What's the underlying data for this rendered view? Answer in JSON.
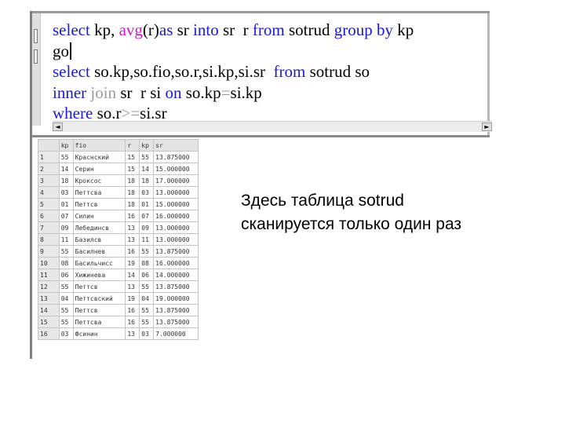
{
  "editor": {
    "lines": [
      [
        {
          "t": "select ",
          "c": "kw"
        },
        {
          "t": "kp, ",
          "c": "txt"
        },
        {
          "t": "avg",
          "c": "fn"
        },
        {
          "t": "(r)",
          "c": "txt"
        },
        {
          "t": "as ",
          "c": "kw"
        },
        {
          "t": "sr ",
          "c": "txt"
        },
        {
          "t": "into ",
          "c": "kw"
        },
        {
          "t": "sr  r ",
          "c": "txt"
        },
        {
          "t": "from ",
          "c": "kw"
        },
        {
          "t": "sotrud ",
          "c": "txt"
        },
        {
          "t": "group by ",
          "c": "kw"
        },
        {
          "t": "kp",
          "c": "txt"
        }
      ],
      [
        {
          "t": "go",
          "c": "txt"
        }
      ],
      [
        {
          "t": "select ",
          "c": "kw"
        },
        {
          "t": "so.kp,so.fio,so.r,si.kp,si.sr  ",
          "c": "txt"
        },
        {
          "t": "from ",
          "c": "kw"
        },
        {
          "t": "sotrud so",
          "c": "txt"
        }
      ],
      [
        {
          "t": "inner ",
          "c": "kw"
        },
        {
          "t": "join ",
          "c": "op"
        },
        {
          "t": "sr  r si ",
          "c": "txt"
        },
        {
          "t": "on ",
          "c": "kw"
        },
        {
          "t": "so.kp",
          "c": "txt"
        },
        {
          "t": "=",
          "c": "op"
        },
        {
          "t": "si.kp",
          "c": "txt"
        }
      ],
      [
        {
          "t": "where ",
          "c": "kw"
        },
        {
          "t": "so.r",
          "c": "txt"
        },
        {
          "t": ">=",
          "c": "op"
        },
        {
          "t": "si.sr",
          "c": "txt"
        }
      ]
    ]
  },
  "grid": {
    "columns": [
      "kp",
      "fio",
      "r",
      "kp",
      "sr"
    ],
    "rows": [
      [
        "1",
        "55",
        "Краснский",
        "15",
        "55",
        "13.875000"
      ],
      [
        "2",
        "14",
        "Серин",
        "15",
        "14",
        "15.000000"
      ],
      [
        "3",
        "18",
        "Кроксос",
        "18",
        "18",
        "17.000000"
      ],
      [
        "4",
        "03",
        "Петтсва",
        "18",
        "03",
        "13.000000"
      ],
      [
        "5",
        "01",
        "Петтсв",
        "18",
        "01",
        "15.000000"
      ],
      [
        "6",
        "07",
        "Силин",
        "16",
        "07",
        "16.000000"
      ],
      [
        "7",
        "09",
        "Лебединсв",
        "13",
        "09",
        "13.000000"
      ],
      [
        "8",
        "11",
        "Базилсв",
        "13",
        "11",
        "13.000000"
      ],
      [
        "9",
        "55",
        "Басилнев",
        "16",
        "55",
        "13.875000"
      ],
      [
        "10",
        "08",
        "Басильчисс",
        "19",
        "08",
        "16.000000"
      ],
      [
        "11",
        "06",
        "Хижинева",
        "14",
        "06",
        "14.000000"
      ],
      [
        "12",
        "55",
        "Петтсв",
        "13",
        "55",
        "13.875000"
      ],
      [
        "13",
        "04",
        "Петтсвский",
        "19",
        "04",
        "19.000000"
      ],
      [
        "14",
        "55",
        "Петтсв",
        "16",
        "55",
        "13.875000"
      ],
      [
        "15",
        "55",
        "Петтсва",
        "16",
        "55",
        "13.875000"
      ],
      [
        "16",
        "03",
        "Фсинин",
        "13",
        "03",
        "7.000000"
      ]
    ]
  },
  "note": {
    "line1": "Здесь таблица sotrud",
    "line2": "сканируется только один раз"
  },
  "scroll": {
    "left_arrow": "◄",
    "right_arrow": "►"
  }
}
